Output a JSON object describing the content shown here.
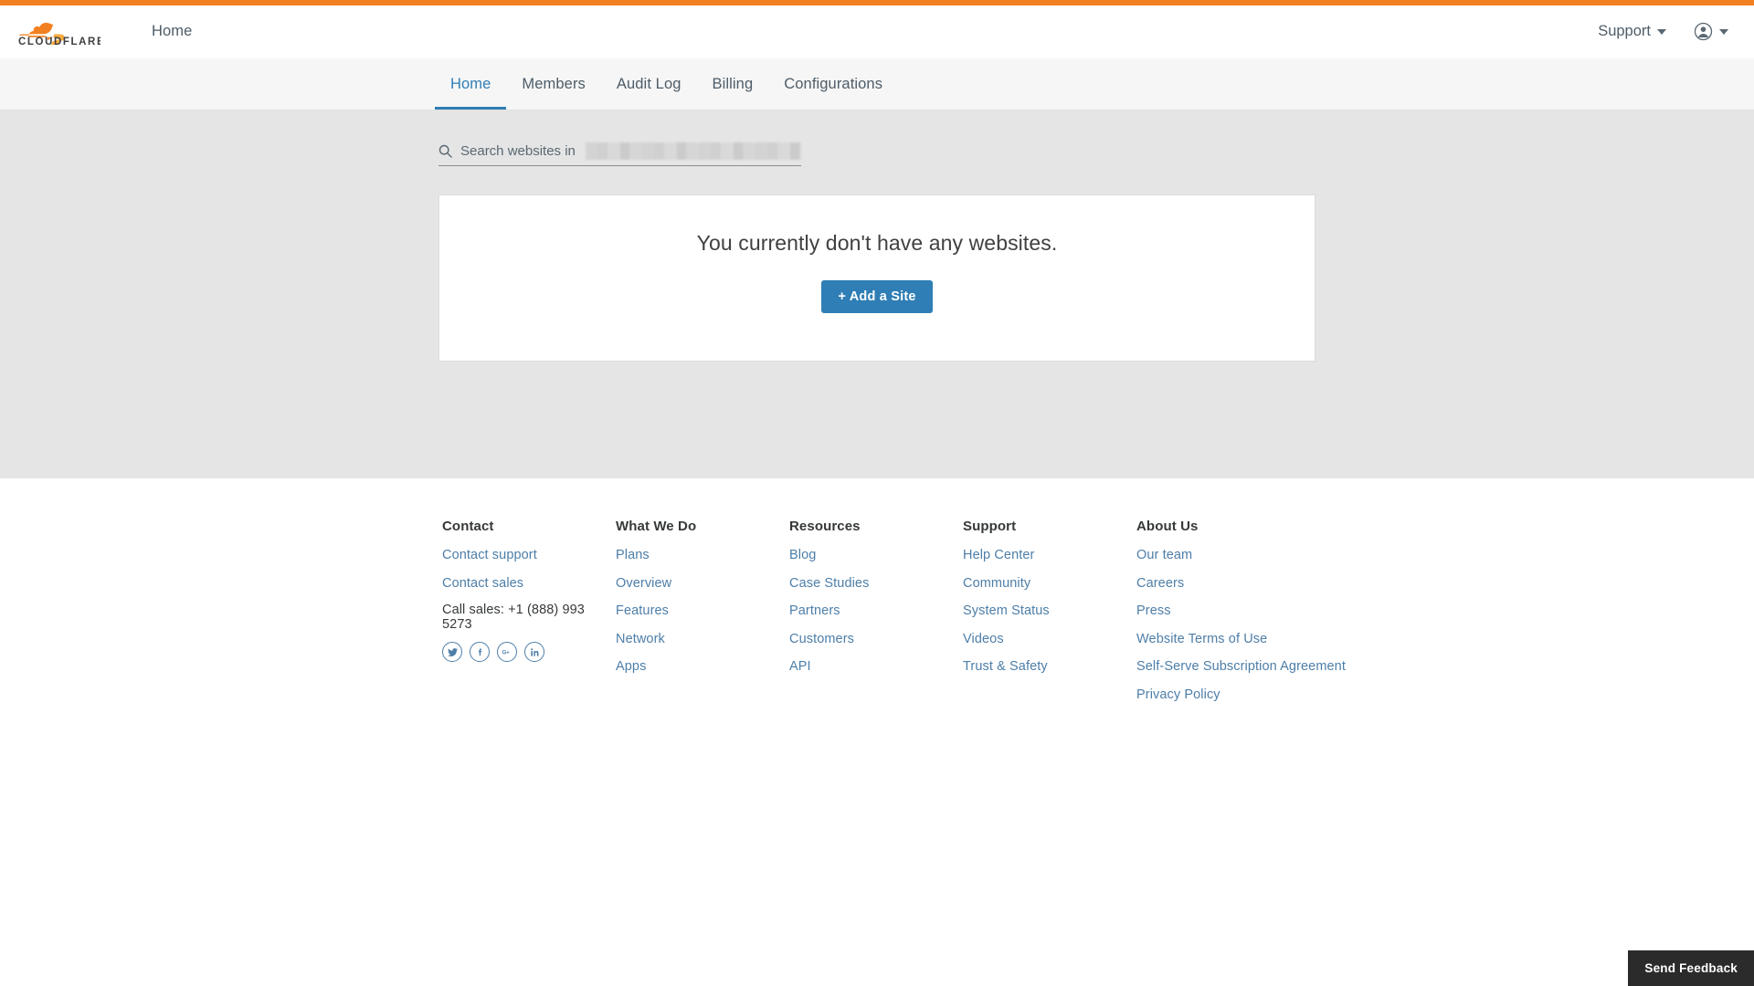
{
  "theme": {
    "brand_orange": "#F38020",
    "accent_blue": "#2F7EB5",
    "link_blue": "#4D7EA8",
    "content_bg": "#E5E5E5",
    "tabbar_bg": "#F6F6F6",
    "text_dark": "#36393A"
  },
  "header": {
    "logo_text": "CLOUDFLARE",
    "logo_icon": "cloudflare-cloud-icon",
    "home_link": "Home",
    "support_label": "Support",
    "support_caret_icon": "chevron-down-icon",
    "account_icon": "account-circle-icon",
    "account_caret_icon": "chevron-down-icon"
  },
  "tabs": [
    {
      "label": "Home",
      "active": true
    },
    {
      "label": "Members",
      "active": false
    },
    {
      "label": "Audit Log",
      "active": false
    },
    {
      "label": "Billing",
      "active": false
    },
    {
      "label": "Configurations",
      "active": false
    }
  ],
  "search": {
    "icon": "search-icon",
    "placeholder": "Search websites in",
    "value": "",
    "redacted_account_name": true
  },
  "main": {
    "empty_message": "You currently don't have any websites.",
    "add_site_label": "+ Add a Site"
  },
  "footer": {
    "columns": [
      {
        "title": "Contact",
        "links": [
          "Contact support",
          "Contact sales"
        ],
        "plain": [
          "Call sales: +1 (888) 993 5273"
        ],
        "social": [
          {
            "name": "twitter-icon",
            "glyph": "twitter"
          },
          {
            "name": "facebook-icon",
            "glyph": "facebook"
          },
          {
            "name": "google-plus-icon",
            "glyph": "googleplus"
          },
          {
            "name": "linkedin-icon",
            "glyph": "linkedin"
          }
        ]
      },
      {
        "title": "What We Do",
        "links": [
          "Plans",
          "Overview",
          "Features",
          "Network",
          "Apps"
        ],
        "plain": [],
        "social": []
      },
      {
        "title": "Resources",
        "links": [
          "Blog",
          "Case Studies",
          "Partners",
          "Customers",
          "API"
        ],
        "plain": [],
        "social": []
      },
      {
        "title": "Support",
        "links": [
          "Help Center",
          "Community",
          "System Status",
          "Videos",
          "Trust & Safety"
        ],
        "plain": [],
        "social": []
      },
      {
        "title": "About Us",
        "links": [
          "Our team",
          "Careers",
          "Press",
          "Website Terms of Use",
          "Self-Serve Subscription Agreement",
          "Privacy Policy"
        ],
        "plain": [],
        "social": []
      }
    ]
  },
  "feedback": {
    "label": "Send Feedback"
  }
}
